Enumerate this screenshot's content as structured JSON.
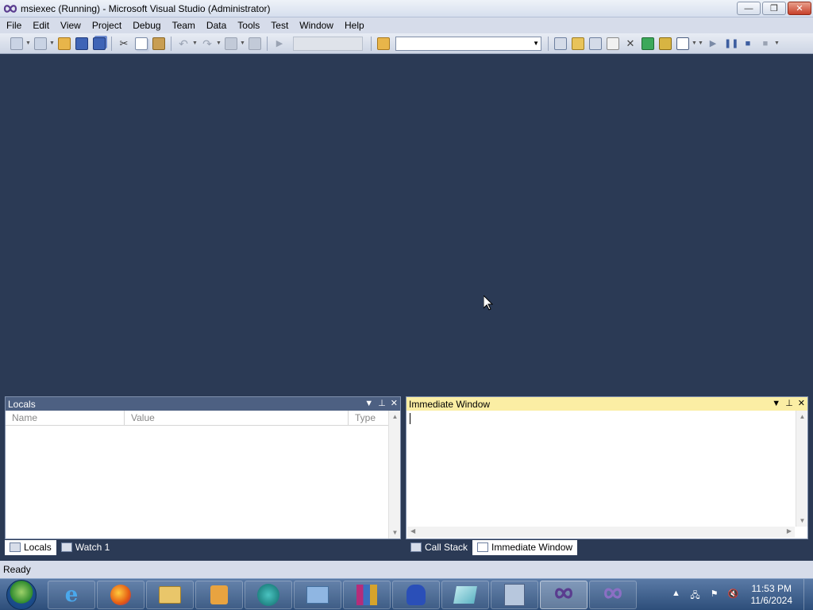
{
  "window": {
    "title": "msiexec (Running) - Microsoft Visual Studio (Administrator)",
    "minimize_icon": "minimize-icon",
    "restore_icon": "restore-icon",
    "close_icon": "close-icon"
  },
  "menu": {
    "items": [
      "File",
      "Edit",
      "View",
      "Project",
      "Debug",
      "Team",
      "Data",
      "Tools",
      "Test",
      "Window",
      "Help"
    ]
  },
  "toolbar": {
    "solution_config_value": "",
    "find_combo_value": ""
  },
  "locals_panel": {
    "title": "Locals",
    "columns": [
      "Name",
      "Value",
      "Type"
    ],
    "rows": []
  },
  "immediate_panel": {
    "title": "Immediate Window",
    "content": ""
  },
  "bottom_tabs_left": [
    {
      "label": "Locals",
      "icon": "locals-icon",
      "active": true
    },
    {
      "label": "Watch 1",
      "icon": "watch-icon",
      "active": false
    }
  ],
  "bottom_tabs_right": [
    {
      "label": "Call Stack",
      "icon": "call-stack-icon",
      "active": false
    },
    {
      "label": "Immediate Window",
      "icon": "immediate-window-icon",
      "active": true
    }
  ],
  "status": {
    "text": "Ready"
  },
  "taskbar": {
    "apps": [
      "internet-explorer-icon",
      "firefox-icon",
      "file-explorer-icon",
      "media-player-icon",
      "teamviewer-icon",
      "control-panel-icon",
      "winrar-icon",
      "sonic-game-icon",
      "notepad-icon",
      "setup-icon",
      "visual-studio-icon",
      "visual-studio-icon"
    ],
    "clock_time": "11:53 PM",
    "clock_date": "11/6/2024"
  },
  "colors": {
    "workspace_bg": "#2b3a55",
    "locals_header_bg": "#4d6082",
    "immediate_header_bg": "#fbeea4"
  }
}
